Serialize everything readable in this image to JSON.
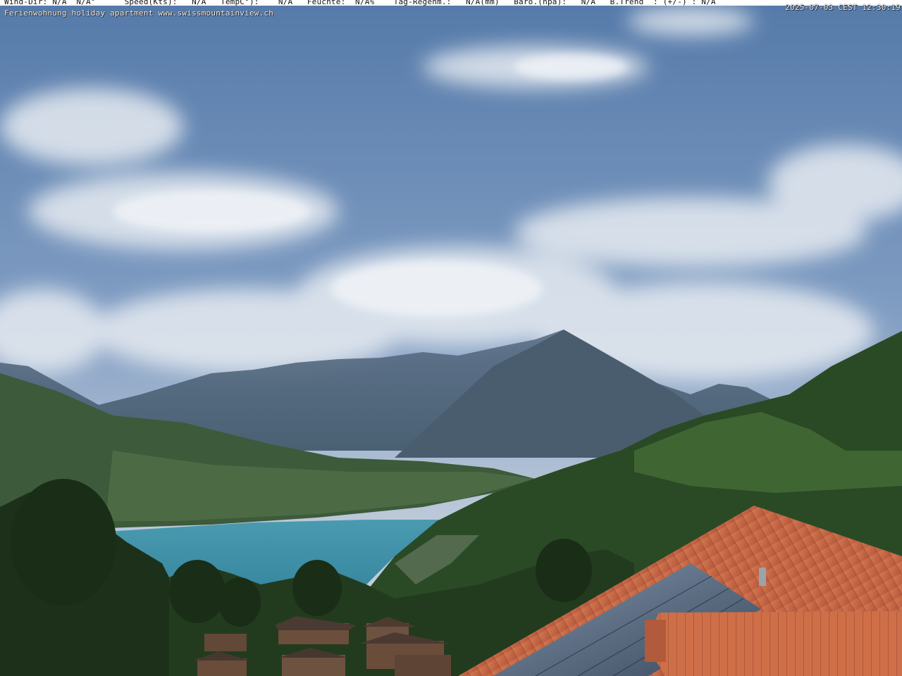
{
  "overlay": {
    "weather_line": "Wind-Dir: N/A  N/A°      Speed(Kts):   N/A   TempC°):    N/A   Feuchte:  N/A%    Tag-Regenm.:   N/A(mm)   Baro.(hpa):   N/A   B.Trend  : (+/-) : N/A",
    "timestamp": "2025-07-03 CEST 12:30:19",
    "caption": "Ferienwohnung holiday apartment www.swissmountainview.ch"
  },
  "colors": {
    "sky_top": "#5a7fae",
    "sky_mid": "#8aa6c8",
    "lake": "#3f8fa8",
    "roof": "#c8643f",
    "forest": "#1f3a1e"
  }
}
